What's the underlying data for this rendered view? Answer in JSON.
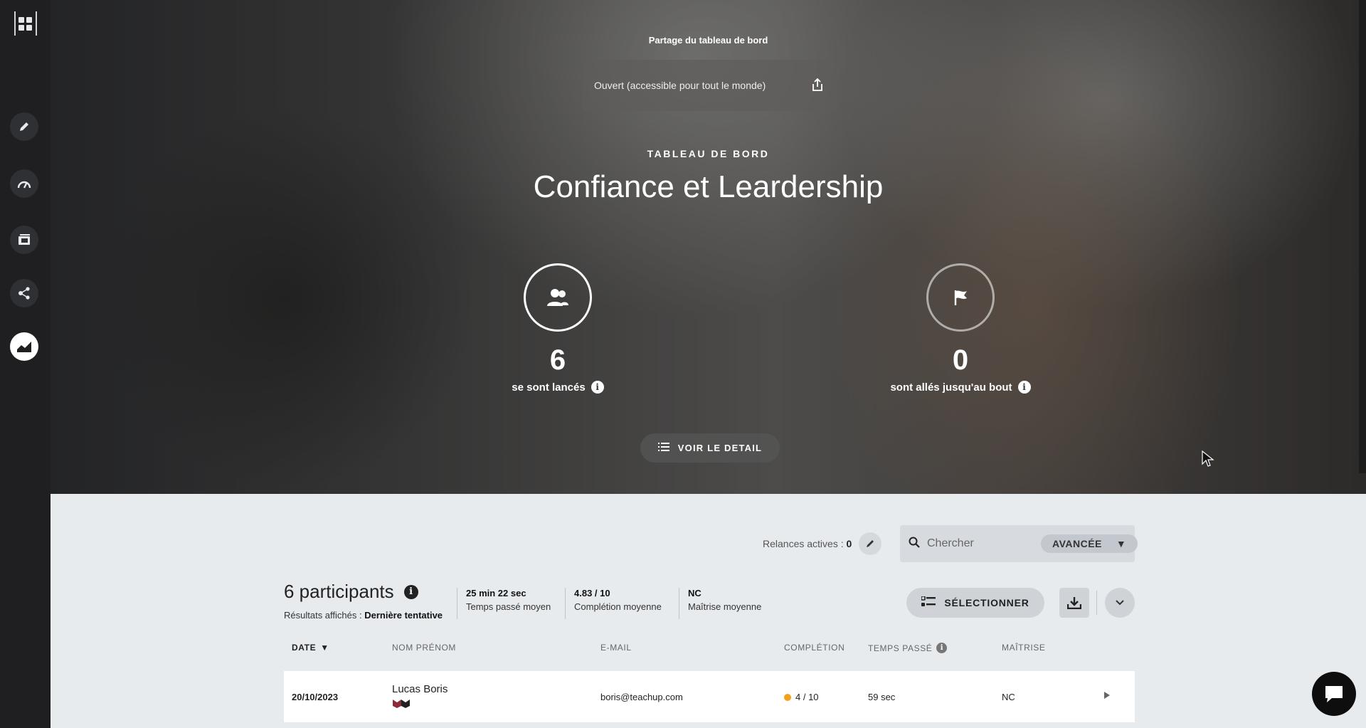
{
  "share": {
    "title": "Partage du tableau de bord",
    "status": "Ouvert (accessible pour tout le monde)"
  },
  "hero": {
    "kicker": "TABLEAU DE BORD",
    "title": "Confiance et Leardership"
  },
  "stats": [
    {
      "value": "6",
      "label": "se sont lancés",
      "icon": "users-icon"
    },
    {
      "value": "0",
      "label": "sont allés jusqu'au bout",
      "icon": "flag-icon"
    }
  ],
  "detail_button": "VOIR LE DETAIL",
  "relances": {
    "label": "Relances actives : ",
    "value": "0"
  },
  "search": {
    "placeholder": "Chercher",
    "advanced": "AVANCÉE"
  },
  "summary": {
    "participants": "6 participants",
    "results_label": "Résultats affichés : ",
    "results_value": "Dernière tentative",
    "kpis": [
      {
        "value": "25 min 22 sec",
        "label": "Temps passé moyen"
      },
      {
        "value": "4.83 / 10",
        "label": "Complétion moyenne"
      },
      {
        "value": "NC",
        "label": "Maîtrise moyenne"
      }
    ]
  },
  "toolbar": {
    "select_label": "SÉLECTIONNER"
  },
  "table": {
    "headers": {
      "date": "DATE",
      "name": "NOM PRÉNOM",
      "email": "E-MAIL",
      "completion": "COMPLÉTION",
      "time": "TEMPS PASSÉ",
      "mastery": "MAÎTRISE"
    },
    "rows": [
      {
        "date": "20/10/2023",
        "name": "Lucas Boris",
        "email": "boris@teachup.com",
        "completion": "4 / 10",
        "time": "59 sec",
        "mastery": "NC",
        "completion_color": "#f0a21a"
      }
    ]
  },
  "rail": {
    "items": [
      "apps-icon",
      "pencil-icon",
      "gauge-icon",
      "media-icon",
      "share-nodes-icon",
      "chart-area-icon"
    ],
    "active": "chart-area-icon"
  }
}
